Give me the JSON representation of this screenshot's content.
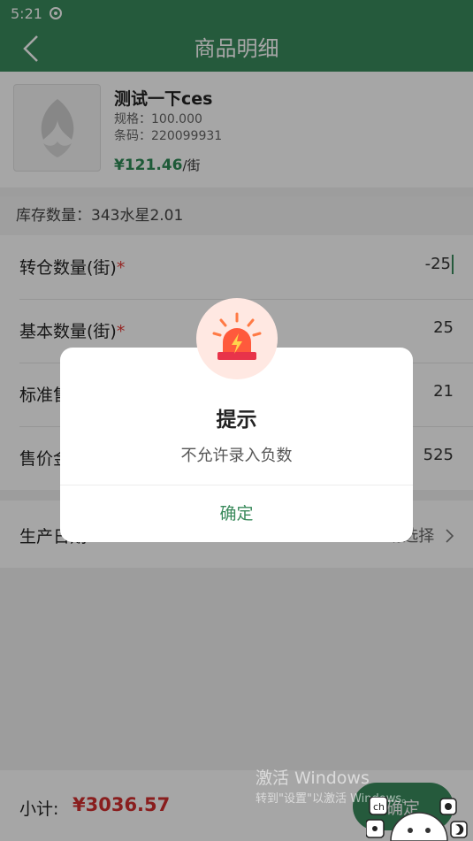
{
  "status": {
    "time": "5:21"
  },
  "header": {
    "title": "商品明细"
  },
  "product": {
    "name": "测试一下ces",
    "spec": "规格：100.000",
    "barcode": "条码：220099931",
    "price": "¥121.46",
    "price_unit": "/街"
  },
  "stock": {
    "text": "库存数量：343水星2.01"
  },
  "form": {
    "rows": [
      {
        "label": "转仓数量(街)",
        "required": "*",
        "value": "-25"
      },
      {
        "label": "基本数量(街)",
        "required": "*",
        "value": "25"
      },
      {
        "label": "标准售价",
        "value": "21"
      },
      {
        "label": "售价金额",
        "value": "525"
      }
    ],
    "date": {
      "label": "生产日期",
      "choose": "请选择"
    }
  },
  "footer": {
    "subtotal_label": "小计:",
    "subtotal": "¥3036.57",
    "confirm_label": "确定"
  },
  "dialog": {
    "title": "提示",
    "message": "不允许录入负数",
    "ok": "确定"
  },
  "watermark": {
    "line1": "激活 Windows",
    "line2": "转到\"设置\"以激活 Windows。"
  },
  "colors": {
    "primary": "#3a8a5c",
    "danger": "#d32f2f",
    "alarm_bg": "#ffe8e2"
  }
}
